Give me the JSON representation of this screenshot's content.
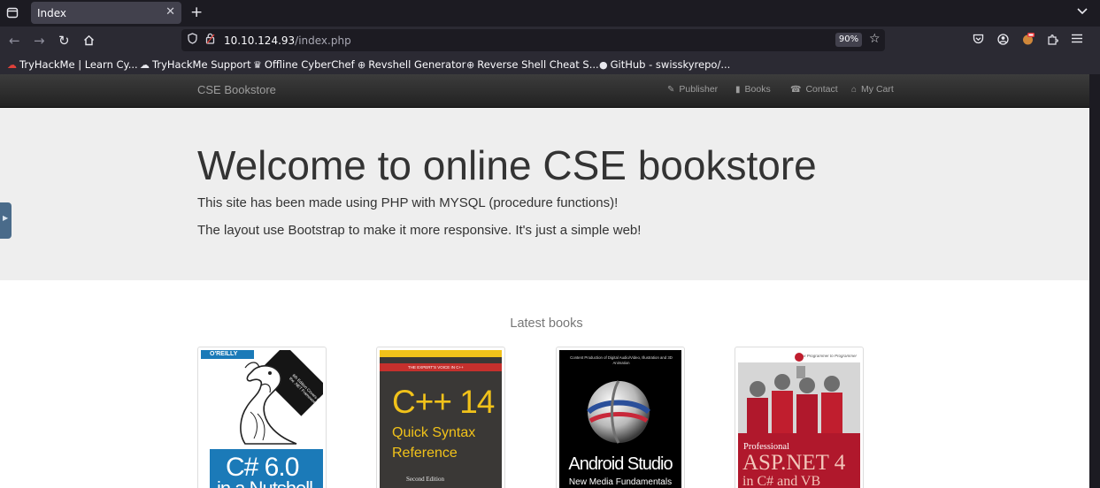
{
  "browser": {
    "tab_title": "Index",
    "url_host": "10.10.124.93",
    "url_path": "/index.php",
    "zoom": "90%",
    "bookmarks": [
      {
        "icon": "tryhackme-icon",
        "glyph": "☁",
        "label": "TryHackMe | Learn Cy..."
      },
      {
        "icon": "support-icon",
        "glyph": "☁",
        "label": "TryHackMe Support"
      },
      {
        "icon": "chef-hat-icon",
        "glyph": "♛",
        "label": "Offline CyberChef"
      },
      {
        "icon": "globe-icon",
        "glyph": "⊕",
        "label": "Revshell Generator"
      },
      {
        "icon": "globe-icon",
        "glyph": "⊕",
        "label": "Reverse Shell Cheat S..."
      },
      {
        "icon": "github-icon",
        "glyph": "●",
        "label": "GitHub - swisskyrepo/..."
      }
    ]
  },
  "site": {
    "brand": "CSE Bookstore",
    "nav": [
      {
        "icon": "pencil-icon",
        "glyph": "✎",
        "label": "Publisher"
      },
      {
        "icon": "book-icon",
        "glyph": "▮",
        "label": "Books"
      },
      {
        "icon": "phone-icon",
        "glyph": "☎",
        "label": "Contact"
      },
      {
        "icon": "cart-icon",
        "glyph": "⌂",
        "label": "My Cart"
      }
    ],
    "heading": "Welcome to online CSE bookstore",
    "intro_1": "This site has been made using PHP with MYSQL (procedure functions)!",
    "intro_2": "The layout use Bootstrap to make it more responsive. It's just a simple web!",
    "latest_label": "Latest books",
    "books": [
      {
        "publisher": "O'REILLY",
        "banner": "6th Edition Covers C# 6.0 & the .NET Framework",
        "title": "C# 6.0",
        "subtitle": "in a Nutshell"
      },
      {
        "publisher": "THE EXPERT'S VOICE IN C++",
        "title": "C++ 14",
        "subtitle_1": "Quick Syntax",
        "subtitle_2": "Reference",
        "edition": "Second Edition"
      },
      {
        "header": "Content Production of Digital Audio/Video, Illustration and 3D Animation",
        "title": "Android Studio",
        "subtitle": "New Media Fundamentals"
      },
      {
        "header": "Wrox Programmer to Programmer",
        "title_pre": "Professional",
        "title": "ASP.NET 4",
        "subtitle": "in C# and VB"
      }
    ]
  },
  "colors": {
    "site_nav": "#222222",
    "jumbotron": "#eeeeee",
    "cs_blue": "#1b7ab8",
    "cpp_yellow": "#f1c21a",
    "asp_red": "#b0182c"
  }
}
